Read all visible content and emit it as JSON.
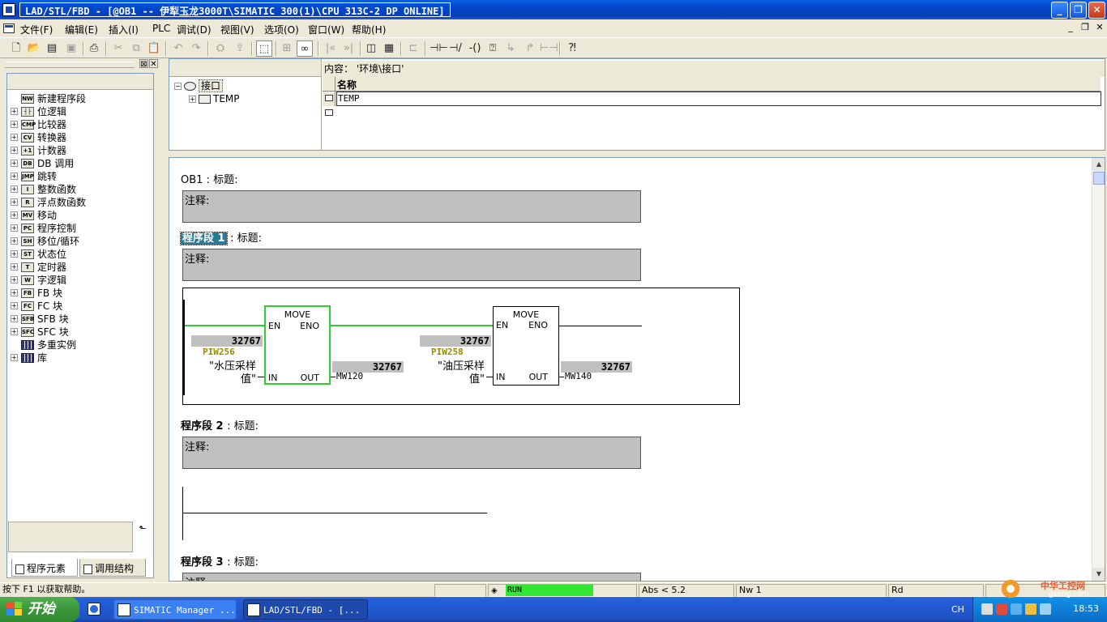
{
  "window": {
    "title": "LAD/STL/FBD  - [@OB1 -- 伊犁玉龙3000T\\SIMATIC 300(1)\\CPU 313C-2 DP  ONLINE]",
    "min": "_",
    "max": "❐",
    "close": "✕"
  },
  "menu": {
    "items": [
      "文件(F)",
      "编辑(E)",
      "插入(I)",
      "PLC",
      "调试(D)",
      "视图(V)",
      "选项(O)",
      "窗口(W)",
      "帮助(H)"
    ],
    "mdi_min": "_",
    "mdi_restore": "❐",
    "mdi_close": "✕"
  },
  "toolbar": {
    "icons": [
      "new-icon",
      "open-icon",
      "download-icon",
      "save-icon",
      "print-icon",
      "cut-icon",
      "copy-icon",
      "paste-icon",
      "undo-icon",
      "redo-icon",
      "compile-icon",
      "load-icon",
      "monitor-icon",
      "network-icon",
      "glasses-icon",
      "prev-icon",
      "next-icon",
      "overview-icon",
      "details-icon",
      "branch-icon",
      "contact-no-icon",
      "contact-nc-icon",
      "coil-icon",
      "box-icon",
      "open-branch-icon",
      "close-branch-icon",
      "connect-icon",
      "help-icon"
    ]
  },
  "left_panel": {
    "items": [
      {
        "label": "新建程序段",
        "icon": "NW",
        "expandable": false
      },
      {
        "label": "位逻辑",
        "icon": "┤├",
        "expandable": true
      },
      {
        "label": "比较器",
        "icon": "CMP",
        "expandable": true
      },
      {
        "label": "转换器",
        "icon": "CV",
        "expandable": true
      },
      {
        "label": "计数器",
        "icon": "+1",
        "expandable": true
      },
      {
        "label": "DB 调用",
        "icon": "DB",
        "expandable": true
      },
      {
        "label": "跳转",
        "icon": "JMP",
        "expandable": true
      },
      {
        "label": "整数函数",
        "icon": "I",
        "expandable": true
      },
      {
        "label": "浮点数函数",
        "icon": "R",
        "expandable": true
      },
      {
        "label": "移动",
        "icon": "MV",
        "expandable": true
      },
      {
        "label": "程序控制",
        "icon": "PC",
        "expandable": true
      },
      {
        "label": "移位/循环",
        "icon": "SH",
        "expandable": true
      },
      {
        "label": "状态位",
        "icon": "ST",
        "expandable": true
      },
      {
        "label": "定时器",
        "icon": "T",
        "expandable": true
      },
      {
        "label": "字逻辑",
        "icon": "W",
        "expandable": true
      },
      {
        "label": "FB 块",
        "icon": "FB",
        "expandable": true
      },
      {
        "label": "FC 块",
        "icon": "FC",
        "expandable": true
      },
      {
        "label": "SFB 块",
        "icon": "SFB",
        "expandable": true
      },
      {
        "label": "SFC 块",
        "icon": "SFC",
        "expandable": true
      },
      {
        "label": "多重实例",
        "icon": "lib",
        "expandable": false
      },
      {
        "label": "库",
        "icon": "lib",
        "expandable": true
      }
    ],
    "tabs": [
      "程序元素",
      "调用结构"
    ],
    "desc_button": "⬑"
  },
  "interface": {
    "root": "接口",
    "child": "TEMP",
    "content_label": "内容：  '环境\\接口'",
    "col_name": "名称",
    "rows": [
      "TEMP",
      ""
    ]
  },
  "program": {
    "block_title": "OB1 : 标题:",
    "comment_label": "注释:",
    "networks": [
      {
        "label_num": "程序段 1",
        "title": ": 标题:"
      },
      {
        "label_num": "程序段 2",
        "title": ": 标题:"
      },
      {
        "label_num": "程序段 3",
        "title": ": 标题:"
      }
    ],
    "move_boxes": [
      {
        "title": "MOVE",
        "en": "EN",
        "eno": "ENO",
        "in": "IN",
        "out": "OUT",
        "in_value": "32767",
        "out_value": "32767",
        "in_addr": "PIW256",
        "in_sym1": "\"水压采样",
        "in_sym2": "值\"",
        "out_operand": "MW120",
        "en_value": "32767"
      },
      {
        "title": "MOVE",
        "en": "EN",
        "eno": "ENO",
        "in": "IN",
        "out": "OUT",
        "in_value": "32767",
        "out_value": "32767",
        "in_addr": "PIW258",
        "in_sym1": "\"油压采样",
        "in_sym2": "值\"",
        "out_operand": "MW140",
        "en_value": "32767"
      }
    ]
  },
  "status_bar": {
    "help": "按下 F1 以获取帮助。",
    "run": "RUN",
    "abs": "Abs < 5.2",
    "nw": "Nw 1",
    "mode": "Rd"
  },
  "taskbar": {
    "start": "开始",
    "tasks": [
      "SIMATIC Manager ...",
      "LAD/STL/FBD  - [..."
    ],
    "lang": "CH",
    "time": "18:53"
  },
  "watermark": {
    "line1": "中华工控网",
    "line2": "gkong.com"
  }
}
